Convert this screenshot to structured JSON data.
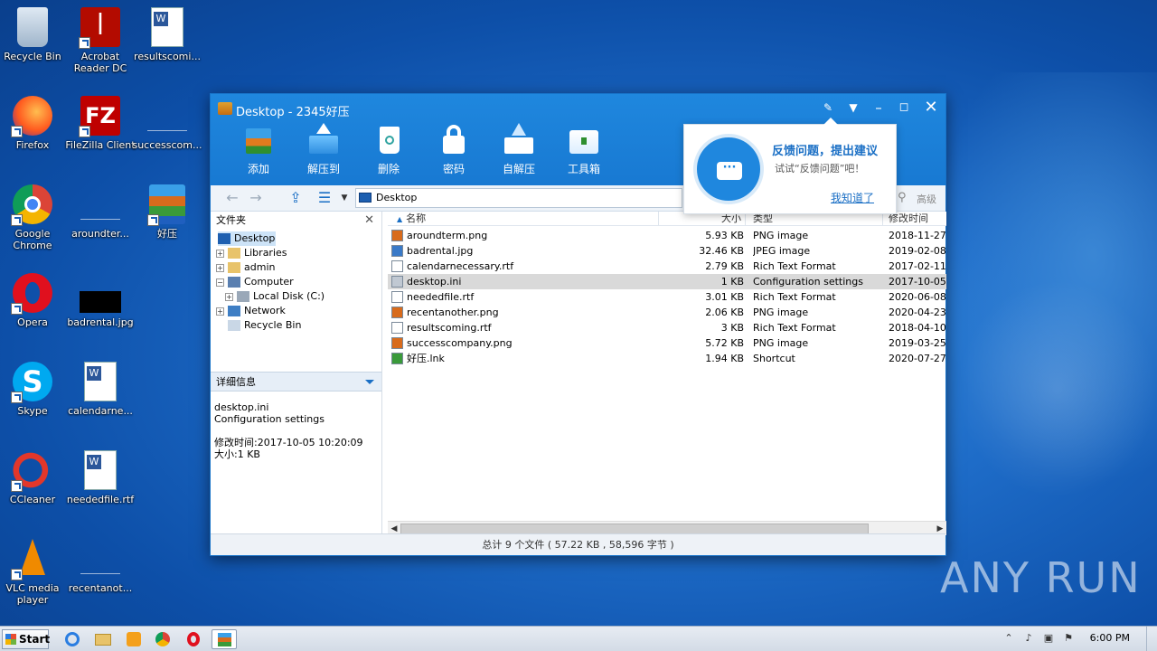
{
  "desktop": {
    "icons": [
      {
        "label": "Recycle Bin"
      },
      {
        "label": "Acrobat Reader DC"
      },
      {
        "label": "resultscomi..."
      },
      {
        "label": "Firefox"
      },
      {
        "label": "FileZilla Client"
      },
      {
        "label": "successcom..."
      },
      {
        "label": "Google Chrome"
      },
      {
        "label": "aroundter..."
      },
      {
        "label": "好压"
      },
      {
        "label": "Opera"
      },
      {
        "label": "badrental.jpg"
      },
      {
        "label": "Skype"
      },
      {
        "label": "calendarne..."
      },
      {
        "label": "CCleaner"
      },
      {
        "label": "neededfile.rtf"
      },
      {
        "label": "VLC media player"
      },
      {
        "label": "recentanot..."
      }
    ]
  },
  "window": {
    "title": "Desktop - 2345好压",
    "toolbar": [
      {
        "label": "添加"
      },
      {
        "label": "解压到"
      },
      {
        "label": "删除"
      },
      {
        "label": "密码"
      },
      {
        "label": "自解压"
      },
      {
        "label": "工具箱"
      }
    ],
    "address": "Desktop",
    "search_partial": "高级",
    "folders_title": "文件夹",
    "tree": [
      {
        "label": "Desktop"
      },
      {
        "label": "Libraries"
      },
      {
        "label": "admin"
      },
      {
        "label": "Computer"
      },
      {
        "label": "Local Disk (C:)"
      },
      {
        "label": "Network"
      },
      {
        "label": "Recycle Bin"
      }
    ],
    "details_title": "详细信息",
    "details": {
      "name": "desktop.ini",
      "type": "Configuration settings",
      "modified": "修改时间:2017-10-05 10:20:09",
      "size": "大小:1 KB"
    },
    "columns": {
      "name": "名称",
      "size": "大小",
      "type": "类型",
      "modified": "修改时间"
    },
    "files": [
      {
        "name": "aroundterm.png",
        "size": "5.93 KB",
        "type": "PNG image",
        "modified": "2018-11-27 1",
        "icon": "png"
      },
      {
        "name": "badrental.jpg",
        "size": "32.46 KB",
        "type": "JPEG image",
        "modified": "2019-02-08 0",
        "icon": "jpg"
      },
      {
        "name": "calendarnecessary.rtf",
        "size": "2.79 KB",
        "type": "Rich Text Format",
        "modified": "2017-02-11 1",
        "icon": "rtf"
      },
      {
        "name": "desktop.ini",
        "size": "1 KB",
        "type": "Configuration settings",
        "modified": "2017-10-05 1",
        "icon": "ini"
      },
      {
        "name": "neededfile.rtf",
        "size": "3.01 KB",
        "type": "Rich Text Format",
        "modified": "2020-06-08 1",
        "icon": "rtf"
      },
      {
        "name": "recentanother.png",
        "size": "2.06 KB",
        "type": "PNG image",
        "modified": "2020-04-23 2",
        "icon": "png"
      },
      {
        "name": "resultscoming.rtf",
        "size": "3 KB",
        "type": "Rich Text Format",
        "modified": "2018-04-10 0",
        "icon": "rtf"
      },
      {
        "name": "successcompany.png",
        "size": "5.72 KB",
        "type": "PNG image",
        "modified": "2019-03-25 1",
        "icon": "png"
      },
      {
        "name": "好压.lnk",
        "size": "1.94 KB",
        "type": "Shortcut",
        "modified": "2020-07-27 1",
        "icon": "lnk"
      }
    ],
    "status": "总计 9 个文件 ( 57.22 KB , 58,596 字节 )"
  },
  "popup": {
    "title": "反馈问题，提出建议",
    "subtitle": "试试“反馈问题”吧！",
    "link": "我知道了"
  },
  "taskbar": {
    "start": "Start",
    "clock": "6:00 PM"
  },
  "watermark": "ANY RUN"
}
